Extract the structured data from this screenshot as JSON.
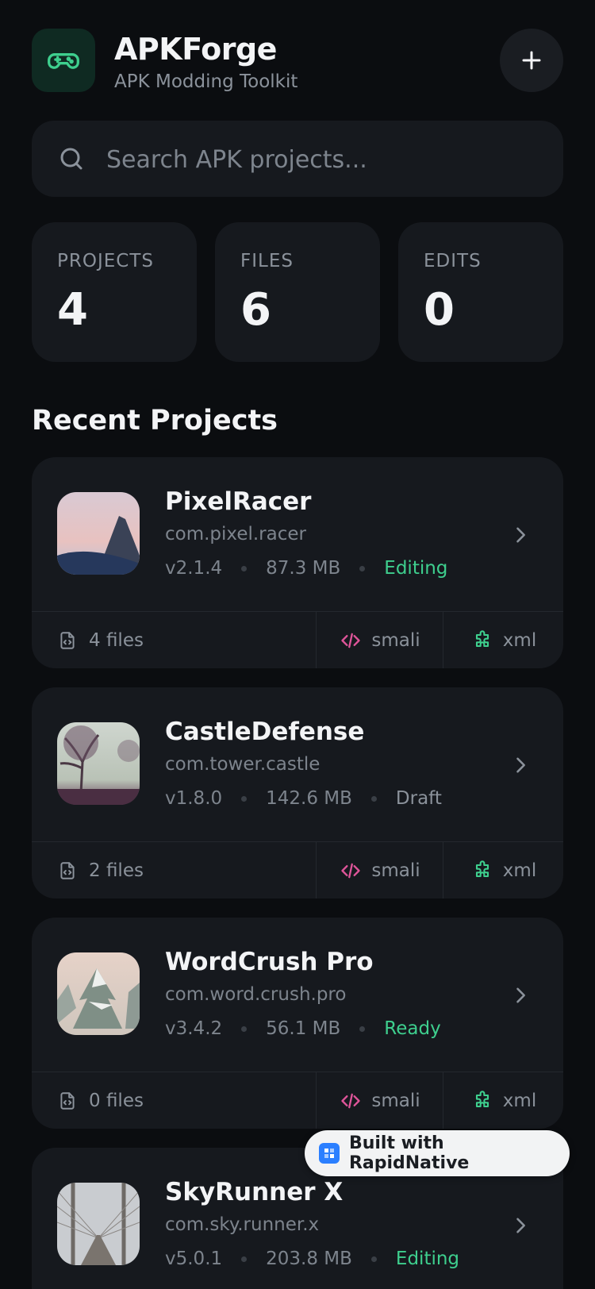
{
  "header": {
    "title": "APKForge",
    "subtitle": "APK Modding Toolkit"
  },
  "search": {
    "placeholder": "Search APK projects...",
    "value": ""
  },
  "stats": [
    {
      "label": "PROJECTS",
      "value": "4"
    },
    {
      "label": "FILES",
      "value": "6"
    },
    {
      "label": "EDITS",
      "value": "0"
    }
  ],
  "section_title": "Recent Projects",
  "projects": [
    {
      "name": "PixelRacer",
      "package": "com.pixel.racer",
      "version": "v2.1.4",
      "size": "87.3 MB",
      "status": "Editing",
      "files": "4 files",
      "smali": "smali",
      "xml": "xml"
    },
    {
      "name": "CastleDefense",
      "package": "com.tower.castle",
      "version": "v1.8.0",
      "size": "142.6 MB",
      "status": "Draft",
      "files": "2 files",
      "smali": "smali",
      "xml": "xml"
    },
    {
      "name": "WordCrush Pro",
      "package": "com.word.crush.pro",
      "version": "v3.4.2",
      "size": "56.1 MB",
      "status": "Ready",
      "files": "0 files",
      "smali": "smali",
      "xml": "xml"
    },
    {
      "name": "SkyRunner X",
      "package": "com.sky.runner.x",
      "version": "v5.0.1",
      "size": "203.8 MB",
      "status": "Editing"
    }
  ],
  "status_colors": {
    "Editing": "#3ecf8e",
    "Ready": "#3ecf8e",
    "Draft": "#8b929b"
  },
  "colors": {
    "accent": "#3ecf8e",
    "smali": "#e0559a",
    "background": "#0b0d10",
    "card": "#16191e"
  },
  "badge": {
    "text": "Built with RapidNative"
  }
}
